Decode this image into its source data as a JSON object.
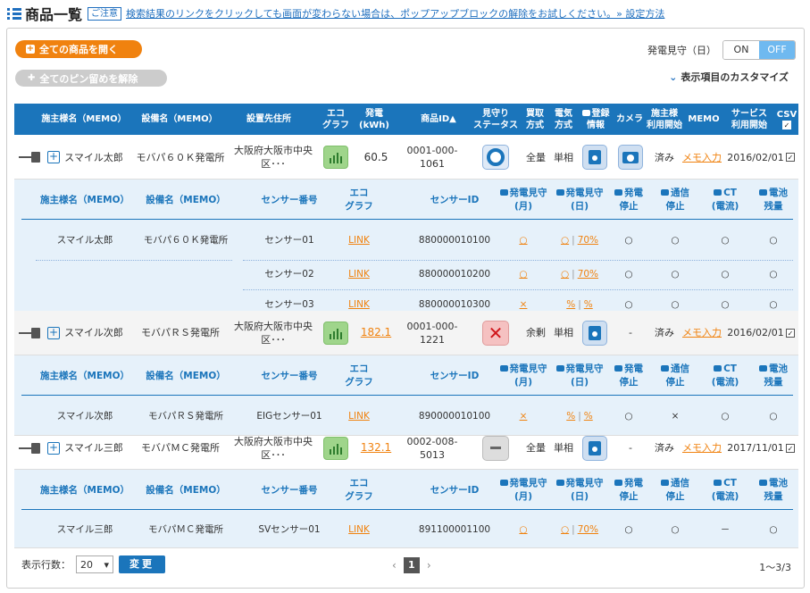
{
  "header": {
    "title": "商品一覧",
    "caution_badge": "ご注意",
    "notice_link": "検索結果のリンクをクリックしても画面が変わらない場合は、ポップアップブロックの解除をお試しください。» 設定方法"
  },
  "actions": {
    "open_all": "全ての商品を開く",
    "clear_pins": "全てのピン留めを解除",
    "toggle_label": "発電見守（日）",
    "toggle_on": "ON",
    "toggle_off": "OFF",
    "customize": "表示項目のカスタマイズ"
  },
  "columns": {
    "owner": "施主様名（MEMO）",
    "facility": "設備名（MEMO）",
    "address": "設置先住所",
    "eco1": "エコ",
    "eco2": "グラフ",
    "gen1": "発電",
    "gen2": "(kWh)",
    "pid": "商品ID▲",
    "watch1": "見守り",
    "watch2": "ステータス",
    "buy1": "買取",
    "buy2": "方式",
    "elec1": "電気",
    "elec2": "方式",
    "reg1": "登録",
    "reg2": "情報",
    "camera": "カメラ",
    "start1": "施主様",
    "start2": "利用開始",
    "memo": "MEMO",
    "svc1": "サービス",
    "svc2": "利用開始",
    "csv": "CSV"
  },
  "sub_columns": {
    "owner": "施主様名（MEMO）",
    "facility": "設備名（MEMO）",
    "sensor": "センサー番号",
    "eco1": "エコ",
    "eco2": "グラフ",
    "sid": "センサーID",
    "wm1": "発電見守",
    "wm2": "(月)",
    "wd1": "発電見守",
    "wd2": "(日)",
    "stop1": "発電",
    "stop2": "停止",
    "comm1": "通信",
    "comm2": "停止",
    "ct1": "CT",
    "ct2": "(電流)",
    "bat1": "電池",
    "bat2": "残量"
  },
  "products": [
    {
      "owner": "スマイル太郎",
      "facility": "モバパ６０Ｋ発電所",
      "addr1": "大阪府大阪市中央",
      "addr2": "区･･･",
      "gen": "60.5",
      "pid": "0001-000-1061",
      "status": "ok",
      "buy": "全量",
      "elec": "単相",
      "camera": true,
      "camera_value": "",
      "start": "済み",
      "memo": "メモ入力",
      "svc": "2016/02/01",
      "sensors": [
        {
          "owner": "スマイル太郎",
          "facility": "モバパ６０Ｋ発電所",
          "no": "センサー01",
          "eco": "LINK",
          "sid": "880000010100",
          "wm": "○",
          "wd_a": "○",
          "wd_b": "70%",
          "stop": "○",
          "comm": "○",
          "ct": "○",
          "bat": "○"
        },
        {
          "owner": "",
          "facility": "",
          "no": "センサー02",
          "eco": "LINK",
          "sid": "880000010200",
          "wm": "○",
          "wd_a": "○",
          "wd_b": "70%",
          "stop": "○",
          "comm": "○",
          "ct": "○",
          "bat": "○"
        },
        {
          "owner": "",
          "facility": "",
          "no": "センサー03",
          "eco": "LINK",
          "sid": "880000010300",
          "wm": "×",
          "wd_a": "%",
          "wd_b": "%",
          "stop": "○",
          "comm": "○",
          "ct": "○",
          "bat": "○"
        }
      ]
    },
    {
      "owner": "スマイル次郎",
      "facility": "モバパＲＳ発電所",
      "addr1": "大阪府大阪市中央",
      "addr2": "区･･･",
      "gen": "182.1",
      "pid": "0001-000-1221",
      "status": "x",
      "buy": "余剰",
      "elec": "単相",
      "camera": false,
      "camera_value": "-",
      "start": "済み",
      "memo": "メモ入力",
      "svc": "2016/02/01",
      "sensors": [
        {
          "owner": "スマイル次郎",
          "facility": "モバパＲＳ発電所",
          "no": "EIGセンサー01",
          "eco": "LINK",
          "sid": "890000010100",
          "wm": "×",
          "wd_a": "%",
          "wd_b": "%",
          "stop": "○",
          "comm": "×",
          "ct": "○",
          "bat": "○"
        }
      ]
    },
    {
      "owner": "スマイル三郎",
      "facility": "モバパＭＣ発電所",
      "addr1": "大阪府大阪市中央",
      "addr2": "区･･･",
      "gen": "132.1",
      "pid": "0002-008-5013",
      "status": "dash",
      "buy": "全量",
      "elec": "単相",
      "camera": false,
      "camera_value": "-",
      "start": "済み",
      "memo": "メモ入力",
      "svc": "2017/11/01",
      "sensors": [
        {
          "owner": "スマイル三郎",
          "facility": "モバパＭＣ発電所",
          "no": "SVセンサー01",
          "eco": "LINK",
          "sid": "891100001100",
          "wm": "○",
          "wd_a": "○",
          "wd_b": "70%",
          "stop": "○",
          "comm": "○",
          "ct": "－",
          "bat": "○"
        }
      ]
    }
  ],
  "footer": {
    "rows_label": "表示行数：",
    "rows_value": "20",
    "change_button": "変更",
    "current_page": "1",
    "count": "1～3/3"
  }
}
